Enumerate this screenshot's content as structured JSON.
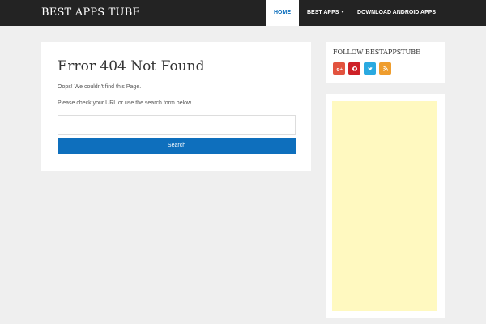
{
  "header": {
    "brand": "BEST APPS TUBE",
    "nav": [
      {
        "label": "HOME",
        "active": true
      },
      {
        "label": "BEST APPS",
        "has_dropdown": true
      },
      {
        "label": "DOWNLOAD ANDROID APPS"
      }
    ]
  },
  "main": {
    "title": "Error 404 Not Found",
    "message": "Oops! We couldn't find this Page.",
    "instruction": "Please check your URL or use the search form below.",
    "search": {
      "value": "",
      "placeholder": ""
    },
    "search_button": "Search"
  },
  "sidebar": {
    "follow_title": "FOLLOW BESTAPPSTUBE",
    "socials": [
      {
        "icon": "google-plus-icon",
        "label": "g+",
        "color": "#e2533f"
      },
      {
        "icon": "pinterest-icon",
        "label": "p",
        "color": "#cd2127"
      },
      {
        "icon": "twitter-icon",
        "label": "t",
        "color": "#2aa9e0"
      },
      {
        "icon": "rss-icon",
        "label": "rss",
        "color": "#ef9d2d"
      }
    ]
  },
  "colors": {
    "accent": "#0e6fbd",
    "topbar": "#232323",
    "background": "#efefef",
    "ad": "#fff9c0"
  }
}
